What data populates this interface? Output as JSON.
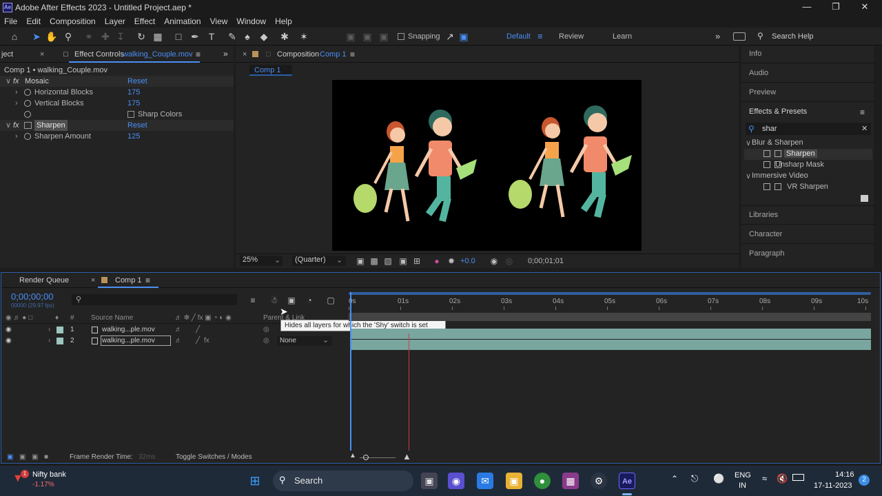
{
  "window": {
    "title": "Adobe After Effects 2023 - Untitled Project.aep *",
    "app_icon": "Ae"
  },
  "menu": [
    "File",
    "Edit",
    "Composition",
    "Layer",
    "Effect",
    "Animation",
    "View",
    "Window",
    "Help"
  ],
  "toolbar": {
    "snapping_label": "Snapping",
    "workspaces": [
      "Default",
      "Review",
      "Learn"
    ],
    "search_help": "Search Help"
  },
  "effect_controls": {
    "tab_prefix": "ject",
    "tab_label": "Effect Controls",
    "tab_file": "walking_Couple.mov",
    "header": "Comp 1 • walking_Couple.mov",
    "effects": [
      {
        "name": "Mosaic",
        "reset": "Reset",
        "params": [
          {
            "name": "Horizontal Blocks",
            "value": "175"
          },
          {
            "name": "Vertical Blocks",
            "value": "175"
          },
          {
            "name": "Sharp Colors",
            "value": ""
          }
        ]
      },
      {
        "name": "Sharpen",
        "reset": "Reset",
        "params": [
          {
            "name": "Sharpen Amount",
            "value": "125"
          }
        ]
      }
    ]
  },
  "composition": {
    "tab_label": "Composition",
    "tab_comp": "Comp 1",
    "sub_tab": "Comp 1",
    "zoom": "25%",
    "resolution": "(Quarter)",
    "exposure": "+0.0",
    "timecode": "0;00;01;01"
  },
  "right_panel": {
    "items_top": [
      "Info",
      "Audio",
      "Preview"
    ],
    "effects_presets": "Effects & Presets",
    "search_value": "shar",
    "tree": [
      {
        "label": "Blur & Sharpen",
        "level": 0
      },
      {
        "label": "Sharpen",
        "level": 1,
        "selected": true
      },
      {
        "label": "Unsharp Mask",
        "level": 1
      },
      {
        "label": "Immersive Video",
        "level": 0
      },
      {
        "label": "VR Sharpen",
        "level": 1
      }
    ],
    "items_bottom": [
      "Libraries",
      "Character",
      "Paragraph"
    ]
  },
  "timeline": {
    "tab_render": "Render Queue",
    "tab_comp": "Comp 1",
    "timecode": "0;00;00;00",
    "fps": "00000 (29.97 fps)",
    "col_source": "Source Name",
    "col_parent": "Parent & Link",
    "col_num": "#",
    "tooltip": "Hides all layers for which the 'Shy' switch is set",
    "ruler": [
      "0s",
      "01s",
      "02s",
      "03s",
      "04s",
      "05s",
      "06s",
      "07s",
      "08s",
      "09s",
      "10s"
    ],
    "playhead_fraction": 0,
    "current_marker_fraction": 0.116,
    "layers": [
      {
        "num": "1",
        "name": "walking...ple.mov",
        "parent": ""
      },
      {
        "num": "2",
        "name": "walking...ple.mov",
        "parent": "None"
      }
    ],
    "frame_render_label": "Frame Render Time:",
    "frame_render_value": "32ms",
    "toggle_label": "Toggle Switches / Modes"
  },
  "taskbar": {
    "stock_name": "Nifty bank",
    "stock_change": "-1.17%",
    "stock_badge": "1",
    "search": "Search",
    "lang": "ENG",
    "region": "IN",
    "time": "14:16",
    "date": "17-11-2023",
    "notif": "2"
  },
  "colors": {
    "accent": "#4a8ff5",
    "layer_bar": "#7aa6a0",
    "playhead": "#d23b3b"
  }
}
